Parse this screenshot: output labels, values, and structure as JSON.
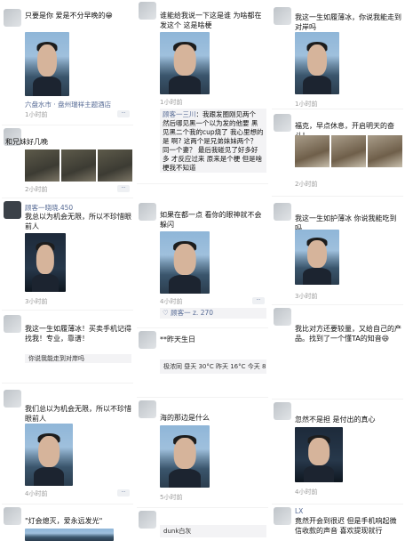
{
  "col1": [
    {
      "text": "只要是你 爱是不分早晚的😁",
      "location": "六盘水市 · 盘州瑞祥主题酒店",
      "time": "1小时前"
    },
    {
      "text": "和兄妹好几晚",
      "time": "2小时前"
    },
    {
      "name": "顾客一晓晓.450",
      "text": "我总以为机会无限，所以不珍惜眼前人",
      "time": "3小时前"
    },
    {
      "text": "我这一生如履薄冰！买卖手机记得找我！专业，靠谱！",
      "link": "你说我能走到对岸吗",
      "time": ""
    },
    {
      "text": "我们总以为机会无限，所以不珍惜眼前人",
      "time": "4小时前"
    },
    {
      "text": "\"灯会熄灭，爱永远发光\""
    }
  ],
  "col2": [
    {
      "text": "谁能给我说一下这是谁 为啥都在发这个 这是啥梗",
      "time": "1小时前"
    },
    {
      "comment_name": "顾客一三川",
      "comment": "：我跟发圈刚见两个 然后哪见黑一个以为发的他要 黑见黑二个我的cup烧了 我心里想的是 啊? 这两个是兄弟妹妹两个？ 同一个妻？ 最后我碰见了好多好多 才反应过来 原来是个梗 但是啥梗我不知道",
      "time": ""
    },
    {
      "text": "如果在都一点 看你的眼神就不会躲闪",
      "time": "4小时前",
      "likes": "顾客一 z. 270"
    },
    {
      "text": "**昨天生日",
      "link": "极浓同 昼天 30°C 昨天 16°C 今天 8°C..."
    },
    {
      "text": "海的那边是什么",
      "time": "5小时前"
    },
    {
      "text": "dunk白灰"
    }
  ],
  "col3": [
    {
      "text": "我这一生如履薄冰，你说我能走到对岸吗",
      "time": "1小时前"
    },
    {
      "text": "福克，早点休息，开启明天的奋斗！",
      "time": "2小时前"
    },
    {
      "text": "我这一生如护薄冰 你说我能吃到吗",
      "time": "3小时前"
    },
    {
      "text": "我比对方还要较量，又给自己的产品。找到了一个懂TA的知音😄",
      "time": ""
    },
    {
      "text": "忽然不是担 是付出的真心",
      "time": "4小时前"
    },
    {
      "name": "LX",
      "text": "竟然开会到很迟 但是手机响起微信收款的声音 喜欢提现就行"
    }
  ],
  "more_label": "··"
}
